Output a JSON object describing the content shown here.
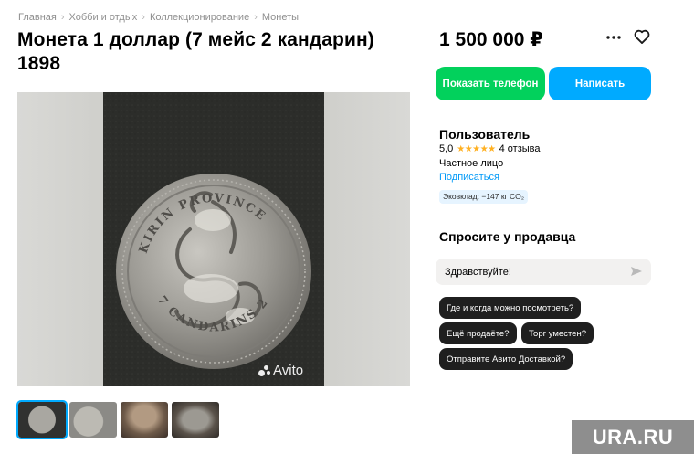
{
  "breadcrumb": [
    "Главная",
    "Хобби и отдых",
    "Коллекционирование",
    "Монеты"
  ],
  "listing": {
    "title": "Монета 1 доллар (7 мейс 2 кандарин) 1898",
    "price": "1 500 000 ₽"
  },
  "actions": {
    "more_icon": "more-horizontal-icon",
    "favorite_icon": "heart-icon",
    "show_phone": "Показать телефон",
    "write": "Написать"
  },
  "gallery": {
    "watermark": "Avito",
    "coin_text_top": "KIRIN PROVINCE",
    "coin_text_bottom": "7 CANDARINS 2",
    "thumbnail_count": 4
  },
  "seller": {
    "name": "Пользователь",
    "rating": "5,0",
    "stars": 5,
    "reviews": "4 отзыва",
    "type": "Частное лицо",
    "subscribe": "Подписаться",
    "eco_badge": "Эковклад: −147 кг CO₂"
  },
  "ask": {
    "title": "Спросите у продавца",
    "message": "Здравствуйте!",
    "send_icon": "send-icon",
    "chips": [
      "Где и когда можно посмотреть?",
      "Ещё продаёте?",
      "Торг уместен?",
      "Отправите Авито Доставкой?"
    ]
  },
  "overlay": {
    "brand": "URA.RU"
  },
  "colors": {
    "green": "#02d15c",
    "blue": "#00aaff",
    "link": "#0099f7",
    "star": "#ffb021",
    "chip": "#1f1f1f"
  }
}
